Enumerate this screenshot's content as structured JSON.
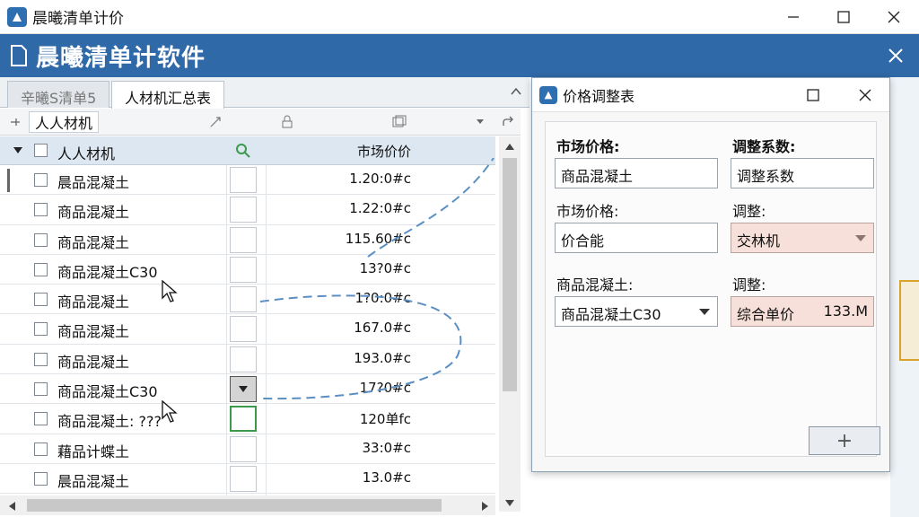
{
  "window": {
    "title": "晨曦清单计价"
  },
  "banner": {
    "title": "晨曦清单计软件"
  },
  "tabs": [
    {
      "label": "辛曦S清单5"
    },
    {
      "label": "人材机汇总表"
    }
  ],
  "toolbar": {
    "group_label": "人人材机"
  },
  "table": {
    "header": {
      "name": "人人材机",
      "price": "市场价价"
    },
    "rows": [
      {
        "name": "晨品混凝土",
        "price": "1.20:0#c"
      },
      {
        "name": "商品混凝土",
        "price": "1.22:0#c"
      },
      {
        "name": "商品混凝土",
        "price": "115.60#c"
      },
      {
        "name": "商品混凝土C30",
        "price": "13?0#c"
      },
      {
        "name": "商品混凝土",
        "price": "1?0:0#c"
      },
      {
        "name": "商品混凝土",
        "price": "167.0#c"
      },
      {
        "name": "商品混凝土",
        "price": "193.0#c"
      },
      {
        "name": "商品混凝土C30",
        "price": "17?0#c"
      },
      {
        "name": "商品混凝土: ???",
        "price": "120单fc"
      },
      {
        "name": "藉品计蝶土",
        "price": "33:0#c"
      },
      {
        "name": "晨品混凝土",
        "price": "13.0#c"
      }
    ]
  },
  "dialog": {
    "title": "价格调整表",
    "market_price_label_1": "市场价格:",
    "market_price_value_1": "商品混凝土",
    "adjust_coef_label": "调整系数:",
    "adjust_coef_value": "调整系数",
    "market_price_label_2": "市场价格:",
    "market_price_value_2": "价合能",
    "adjust_label_1": "调整:",
    "adjust_value_1": "交林机",
    "concrete_label": "商品混凝土:",
    "concrete_value": "商品混凝土C30",
    "adjust_label_2": "调整:",
    "unit_price_label": "综合单价",
    "unit_price_value": "133.M",
    "add_button": "+"
  },
  "icons": [
    "app-icon",
    "minimize-icon",
    "maximize-icon",
    "close-icon",
    "search-icon",
    "dropdown-arrow-icon",
    "mouse-cursor-icon",
    "plus-icon"
  ]
}
